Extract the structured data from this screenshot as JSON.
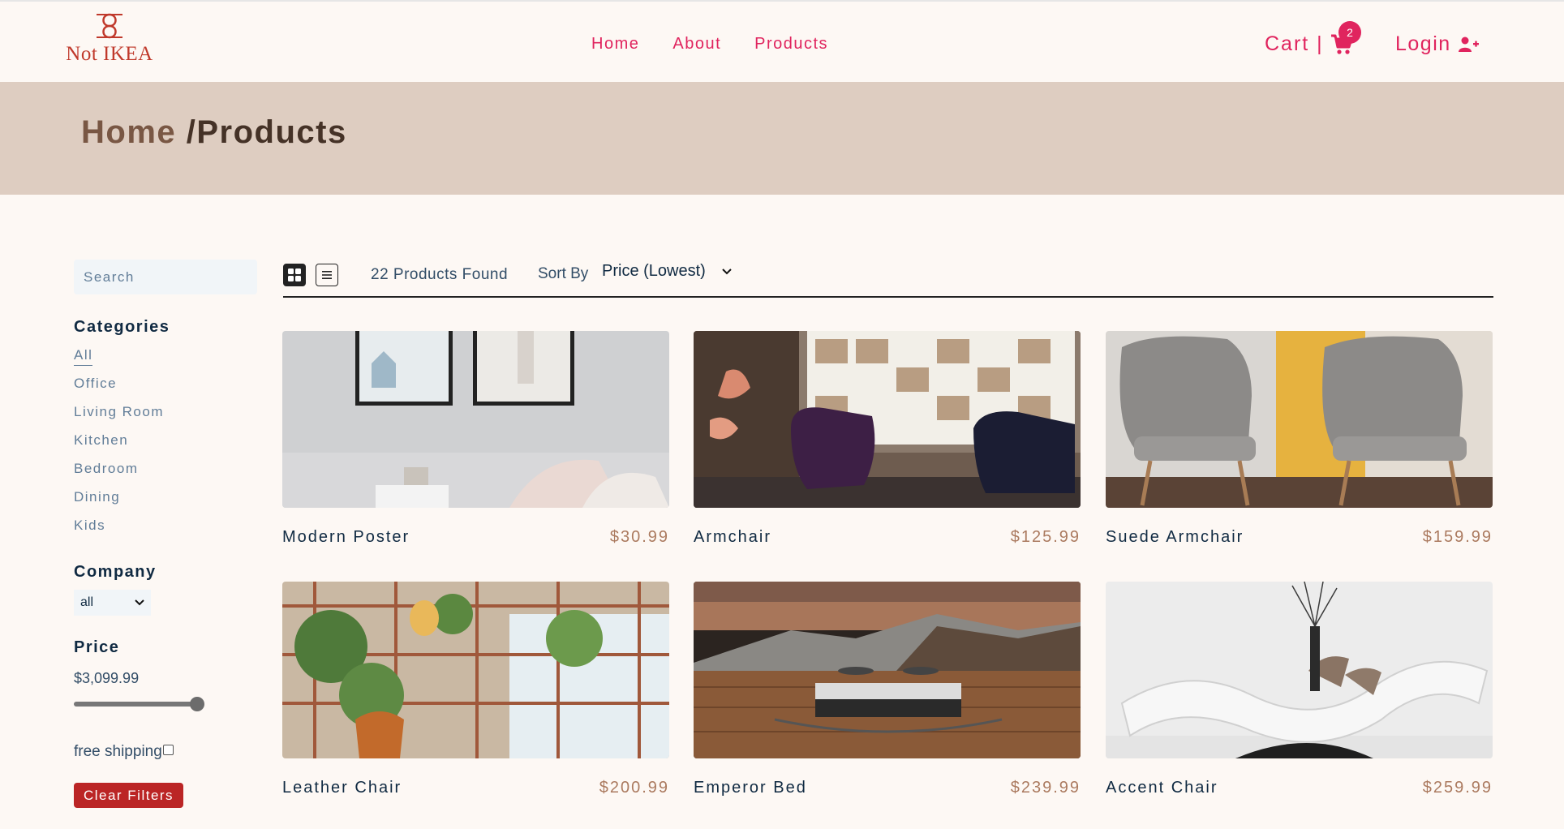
{
  "brand": {
    "logo_text": "Not IKEA"
  },
  "nav": {
    "links": [
      {
        "label": "Home"
      },
      {
        "label": "About"
      },
      {
        "label": "Products"
      }
    ]
  },
  "cart": {
    "label": "Cart |",
    "count": "2"
  },
  "login": {
    "label": "Login"
  },
  "hero": {
    "home": "Home",
    "current": "/Products"
  },
  "filters": {
    "search_placeholder": "Search",
    "categories_title": "Categories",
    "categories": [
      "All",
      "Office",
      "Living Room",
      "Kitchen",
      "Bedroom",
      "Dining",
      "Kids"
    ],
    "active_category": "All",
    "company_title": "Company",
    "company_selected": "all",
    "price_title": "Price",
    "price_value": "$3,099.99",
    "price_level": 1.0,
    "shipping_label": "free shipping",
    "shipping_checked": false,
    "clear_label": "Clear Filters"
  },
  "sort": {
    "products_found": "22 Products Found",
    "label": "Sort By",
    "selected": "Price (Lowest)",
    "view_mode": "grid"
  },
  "products": [
    {
      "name": "Modern Poster",
      "price": "$30.99"
    },
    {
      "name": "Armchair",
      "price": "$125.99"
    },
    {
      "name": "Suede Armchair",
      "price": "$159.99"
    },
    {
      "name": "Leather Chair",
      "price": "$200.99"
    },
    {
      "name": "Emperor Bed",
      "price": "$239.99"
    },
    {
      "name": "Accent Chair",
      "price": "$259.99"
    }
  ],
  "colors": {
    "accent": "#e0245e",
    "hero_bg": "#decdc1",
    "price": "#ab7a5f",
    "clear_button": "#bb2525"
  }
}
